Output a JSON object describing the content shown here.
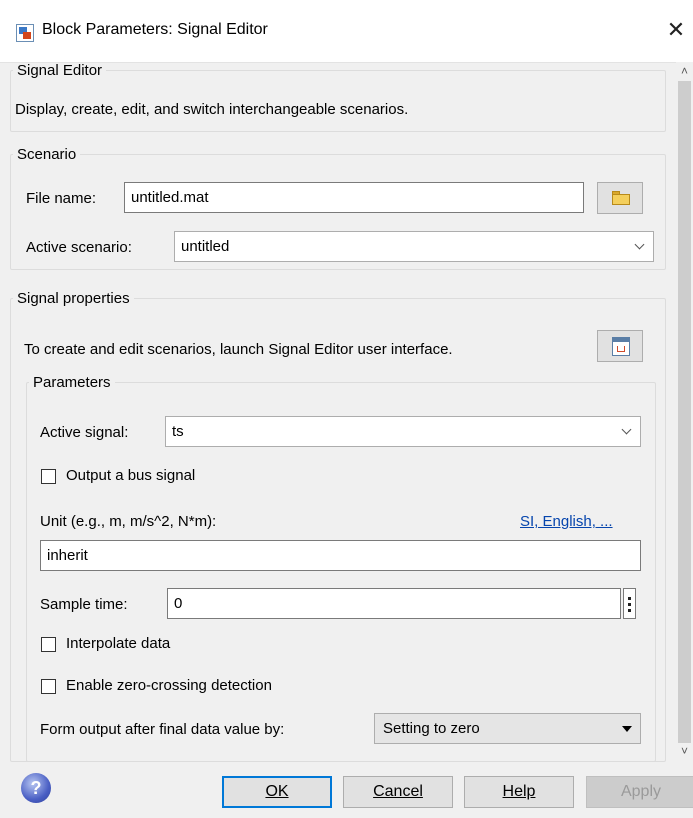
{
  "window": {
    "title": "Block Parameters: Signal Editor",
    "close_glyph": "✕",
    "icon": "simulink-block-icon"
  },
  "signal_editor_group": {
    "legend": "Signal Editor",
    "description": "Display, create, edit, and switch interchangeable scenarios."
  },
  "scenario_group": {
    "legend": "Scenario",
    "file_name_label": "File name:",
    "file_name_value": "untitled.mat",
    "browse_icon": "folder-icon",
    "active_scenario_label": "Active scenario:",
    "active_scenario_value": "untitled"
  },
  "signal_properties_group": {
    "legend": "Signal properties",
    "launch_text": "To create and edit scenarios, launch Signal Editor user interface.",
    "launch_icon": "signal-editor-icon"
  },
  "parameters_group": {
    "legend": "Parameters",
    "active_signal_label": "Active signal:",
    "active_signal_value": "ts",
    "output_bus_label": "Output a bus signal",
    "output_bus_checked": false,
    "unit_label": "Unit (e.g., m, m/s^2, N*m):",
    "unit_link": "SI, English, ...",
    "unit_value": "inherit",
    "sample_time_label": "Sample time:",
    "sample_time_value": "0",
    "interpolate_label": "Interpolate data",
    "interpolate_checked": false,
    "zero_crossing_label": "Enable zero-crossing detection",
    "zero_crossing_checked": false,
    "form_output_label": "Form output after final data value by:",
    "form_output_value": "Setting to zero"
  },
  "buttons": {
    "ok": "OK",
    "cancel": "Cancel",
    "help": "Help",
    "apply": "Apply",
    "help_glyph": "?"
  },
  "colors": {
    "accent": "#0078d7",
    "link": "#0645ad",
    "background": "#f0f0f0"
  }
}
